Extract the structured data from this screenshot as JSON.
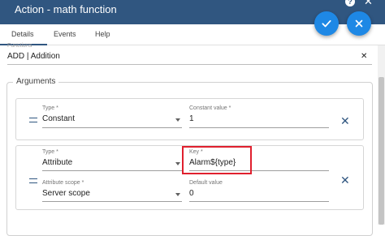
{
  "dialog": {
    "title": "Action - math function",
    "help_glyph": "?",
    "close_glyph": "✕"
  },
  "tabs": [
    {
      "label": "Details",
      "active": true
    },
    {
      "label": "Events"
    },
    {
      "label": "Help"
    }
  ],
  "functions": {
    "label": "Functions",
    "value": "ADD | Addition",
    "clear_glyph": "✕"
  },
  "arguments": {
    "legend": "Arguments",
    "remove_glyph": "✕",
    "items": [
      {
        "type_label": "Type *",
        "type_value": "Constant",
        "value_label": "Constant value *",
        "value": "1"
      },
      {
        "type_label": "Type *",
        "type_value": "Attribute",
        "key_label": "Key *",
        "key_value": "Alarm${type}",
        "scope_label": "Attribute scope *",
        "scope_value": "Server scope",
        "default_label": "Default value",
        "default_value": "0"
      }
    ]
  },
  "colors": {
    "header": "#305680",
    "fab": "#1e88e5",
    "highlight": "#e0202e"
  },
  "icons": {
    "save": "check-icon",
    "cancel": "close-icon",
    "drag": "drag-handle-icon"
  }
}
